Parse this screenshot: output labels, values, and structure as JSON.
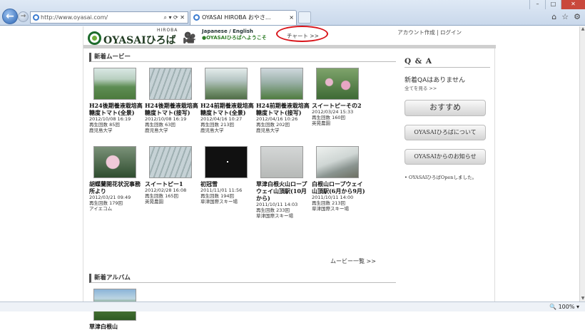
{
  "browser": {
    "url": "http://www.oyasai.com/",
    "tab_title": "OYASAI HIROBA おやさ...",
    "tab_close": "×",
    "window_controls": [
      "–",
      "□",
      "✕"
    ],
    "zoom": "100%",
    "back": "←",
    "forward": "→"
  },
  "header": {
    "logo_text": "OYASAIひろば",
    "logo_small": "HIROBA",
    "lang": "Japanese / English",
    "welcome": "●OYASAIひろばへようこそ",
    "chart_link": "チャート >>",
    "account": "アカウント作成 | ログイン"
  },
  "movies": {
    "section_title": "新着ムービー",
    "more": "ムービー一覧 >>",
    "items": [
      {
        "title": "H24後期養液栽培高糖度トマト(全景)",
        "date": "2012/10/08 16:19",
        "plays": "再生回数 85回",
        "owner": "鹿児島大学",
        "thumb": "green"
      },
      {
        "title": "H24後期養液栽培高糖度トマト(接写)",
        "date": "2012/10/08 16:19",
        "plays": "再生回数 63回",
        "owner": "鹿児島大学",
        "thumb": "gh"
      },
      {
        "title": "H24前期養液栽培高糖度トマト(全景)",
        "date": "2012/04/16 10:27",
        "plays": "再生回数 213回",
        "owner": "鹿児島大学",
        "thumb": "gh2"
      },
      {
        "title": "H24前期養液栽培高糖度トマト(接写)",
        "date": "2012/04/16 10:26",
        "plays": "再生回数 202回",
        "owner": "鹿児島大学",
        "thumb": "mix"
      },
      {
        "title": "スイートピーその2",
        "date": "2012/03/24 15:33",
        "plays": "再生回数 160回",
        "owner": "英晃農園",
        "thumb": "flower"
      },
      {
        "title": "胡蝶蘭開花状況事務所より",
        "date": "2012/03/21 09:49",
        "plays": "再生回数 179回",
        "owner": "アイエコム",
        "thumb": "pink"
      },
      {
        "title": "スイートピー1",
        "date": "2012/02/28 16:08",
        "plays": "再生回数 165回",
        "owner": "英晃農園",
        "thumb": "gh"
      },
      {
        "title": "初冠雪",
        "date": "2011/11/01 11:56",
        "plays": "再生回数 194回",
        "owner": "草津国際スキー場",
        "thumb": "night"
      },
      {
        "title": "草津白根火山ロープウェイ山頂駅(10月から)",
        "date": "2011/10/11 14:03",
        "plays": "再生回数 233回",
        "owner": "草津国際スキー場",
        "thumb": "fog"
      },
      {
        "title": "白根山ロープウェイ山頂駅(6月から9月)",
        "date": "2011/10/11 14:00",
        "plays": "再生回数 213回",
        "owner": "草津国際スキー場",
        "thumb": "mountain"
      }
    ]
  },
  "albums": {
    "section_title": "新着アルバム",
    "items": [
      {
        "title": "草津白根山",
        "thumb": "album"
      }
    ]
  },
  "sidebar": {
    "qa_title": "Q & A",
    "qa_none": "新着QAはありません",
    "qa_all": "全てを見る >>",
    "btn_recommend": "おすすめ",
    "btn_about": "OYASAIひろばについて",
    "btn_news": "OYASAIからのお知らせ",
    "news_item": "• OYASAIひろばOpenしました。"
  }
}
